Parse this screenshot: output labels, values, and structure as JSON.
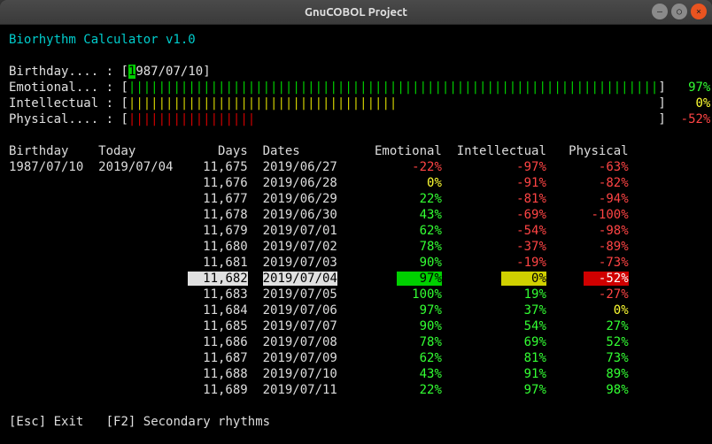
{
  "window": {
    "title": "GnuCOBOL Project"
  },
  "app": {
    "title": "Biorhythm Calculator v1.0",
    "birthday_label": "Birthday.... :",
    "emotional_label": "Emotional... :",
    "intellectual_label": "Intellectual :",
    "physical_label": "Physical.... :",
    "birthday_value": "1987/07/10",
    "emotional_pct": "97%",
    "intellectual_pct": "0%",
    "physical_pct": "-52%",
    "emotional_bar_len": 71,
    "intellectual_bar_len": 36,
    "physical_bar_len": 17,
    "bar_total_width": 71,
    "cursor_char": "1",
    "input_rest": "987/07/10"
  },
  "table": {
    "headers": {
      "birthday": "Birthday",
      "today": "Today",
      "days": "Days",
      "dates": "Dates",
      "emotional": "Emotional",
      "intellectual": "Intellectual",
      "physical": "Physical"
    },
    "birthday": "1987/07/10",
    "today": "2019/07/04",
    "rows": [
      {
        "days": "11,675",
        "date": "2019/06/27",
        "emo": "-22%",
        "int": "-97%",
        "phy": "-63%",
        "hl": false
      },
      {
        "days": "11,676",
        "date": "2019/06/28",
        "emo": "0%",
        "int": "-91%",
        "phy": "-82%",
        "hl": false
      },
      {
        "days": "11,677",
        "date": "2019/06/29",
        "emo": "22%",
        "int": "-81%",
        "phy": "-94%",
        "hl": false
      },
      {
        "days": "11,678",
        "date": "2019/06/30",
        "emo": "43%",
        "int": "-69%",
        "phy": "-100%",
        "hl": false
      },
      {
        "days": "11,679",
        "date": "2019/07/01",
        "emo": "62%",
        "int": "-54%",
        "phy": "-98%",
        "hl": false
      },
      {
        "days": "11,680",
        "date": "2019/07/02",
        "emo": "78%",
        "int": "-37%",
        "phy": "-89%",
        "hl": false
      },
      {
        "days": "11,681",
        "date": "2019/07/03",
        "emo": "90%",
        "int": "-19%",
        "phy": "-73%",
        "hl": false
      },
      {
        "days": "11,682",
        "date": "2019/07/04",
        "emo": "97%",
        "int": "0%",
        "phy": "-52%",
        "hl": true
      },
      {
        "days": "11,683",
        "date": "2019/07/05",
        "emo": "100%",
        "int": "19%",
        "phy": "-27%",
        "hl": false
      },
      {
        "days": "11,684",
        "date": "2019/07/06",
        "emo": "97%",
        "int": "37%",
        "phy": "0%",
        "hl": false
      },
      {
        "days": "11,685",
        "date": "2019/07/07",
        "emo": "90%",
        "int": "54%",
        "phy": "27%",
        "hl": false
      },
      {
        "days": "11,686",
        "date": "2019/07/08",
        "emo": "78%",
        "int": "69%",
        "phy": "52%",
        "hl": false
      },
      {
        "days": "11,687",
        "date": "2019/07/09",
        "emo": "62%",
        "int": "81%",
        "phy": "73%",
        "hl": false
      },
      {
        "days": "11,688",
        "date": "2019/07/10",
        "emo": "43%",
        "int": "91%",
        "phy": "89%",
        "hl": false
      },
      {
        "days": "11,689",
        "date": "2019/07/11",
        "emo": "22%",
        "int": "97%",
        "phy": "98%",
        "hl": false
      }
    ]
  },
  "footer": {
    "esc_key": "[Esc]",
    "esc_text": "Exit",
    "f2_key": "[F2]",
    "f2_text": "Secondary rhythms"
  }
}
